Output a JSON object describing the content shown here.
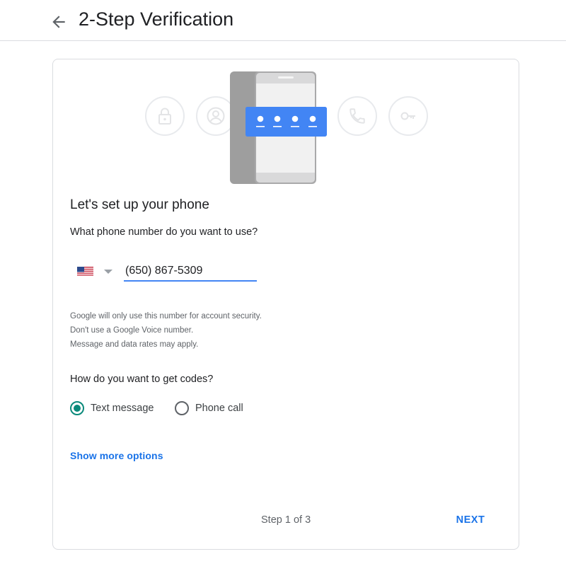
{
  "header": {
    "back_icon": "arrow-back-icon",
    "title": "2-Step Verification"
  },
  "hero": {
    "icons": [
      "lock-icon",
      "account-icon",
      "phone-icon",
      "key-icon"
    ],
    "accent": "#4285f4"
  },
  "form": {
    "title": "Let's set up your phone",
    "phone_question": "What phone number do you want to use?",
    "country_flag": "us-flag-icon",
    "phone_value": "(650) 867-5309",
    "help_lines": [
      "Google will only use this number for account security.",
      "Don't use a Google Voice number.",
      "Message and data rates may apply."
    ],
    "codes_question": "How do you want to get codes?",
    "options": [
      {
        "label": "Text message",
        "selected": true
      },
      {
        "label": "Phone call",
        "selected": false
      }
    ],
    "more_options": "Show more options"
  },
  "footer": {
    "step": "Step 1 of 3",
    "next": "NEXT"
  },
  "colors": {
    "primary": "#1a73e8",
    "radio_selected": "#0b8a7b",
    "border": "#dadce0"
  }
}
